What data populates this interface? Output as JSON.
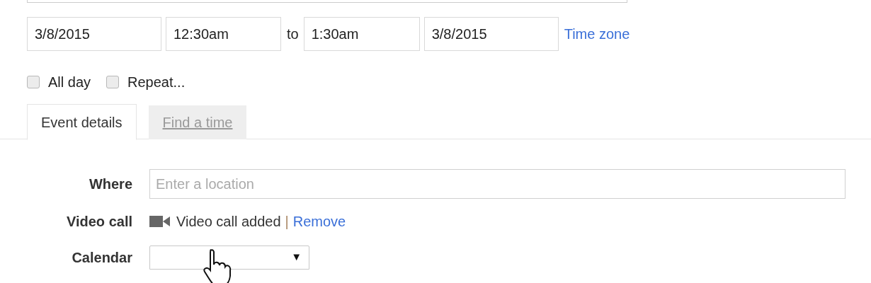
{
  "date_time": {
    "start_date": "3/8/2015",
    "start_time": "12:30am",
    "separator": "to",
    "end_time": "1:30am",
    "end_date": "3/8/2015",
    "time_zone_link": "Time zone"
  },
  "options": [
    {
      "label": "All day",
      "checked": false
    },
    {
      "label": "Repeat...",
      "checked": false
    }
  ],
  "tabs": [
    {
      "label": "Event details",
      "selected": true
    },
    {
      "label": "Find a time",
      "selected": false
    }
  ],
  "where": {
    "label": "Where",
    "placeholder": "Enter a location"
  },
  "video_call": {
    "label": "Video call",
    "status": "Video call added",
    "separator": "|",
    "action": "Remove"
  },
  "calendar": {
    "label": "Calendar",
    "caret": "▼"
  }
}
